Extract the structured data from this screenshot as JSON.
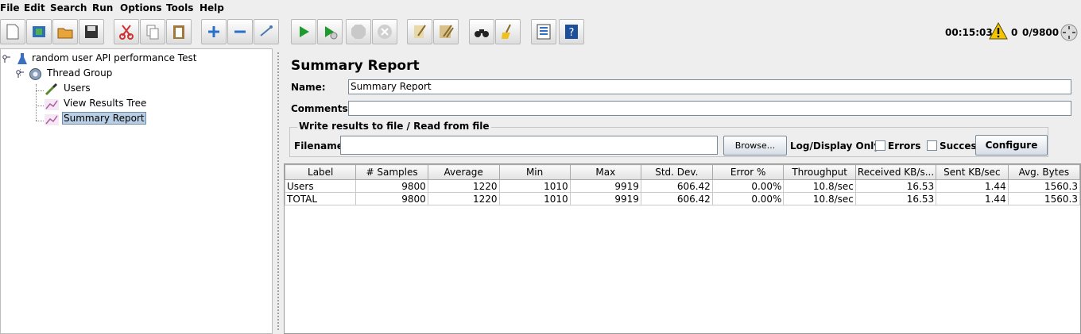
{
  "menu": {
    "file": "File",
    "edit": "Edit",
    "search": "Search",
    "run": "Run",
    "options": "Options",
    "tools": "Tools",
    "help": "Help"
  },
  "status": {
    "elapsed": "00:15:03",
    "warnings": "0",
    "threads": "0/9800"
  },
  "tree": {
    "root": "random user API performance Test",
    "thread_group": "Thread Group",
    "users": "Users",
    "view_results_tree": "View Results Tree",
    "summary_report": "Summary Report"
  },
  "panel": {
    "title": "Summary Report",
    "name_label": "Name:",
    "name_value": "Summary Report",
    "comments_label": "Comments:",
    "comments_value": "",
    "group_title": "Write results to file / Read from file",
    "filename_label": "Filename",
    "filename_value": "",
    "browse_button": "Browse...",
    "log_display_label": "Log/Display Only:",
    "errors_label": "Errors",
    "successes_label": "Successes",
    "configure_button": "Configure"
  },
  "table": {
    "columns": [
      "Label",
      "# Samples",
      "Average",
      "Min",
      "Max",
      "Std. Dev.",
      "Error %",
      "Throughput",
      "Received KB/s...",
      "Sent KB/sec",
      "Avg. Bytes"
    ],
    "rows": [
      [
        "Users",
        "9800",
        "1220",
        "1010",
        "9919",
        "606.42",
        "0.00%",
        "10.8/sec",
        "16.53",
        "1.44",
        "1560.3"
      ],
      [
        "TOTAL",
        "9800",
        "1220",
        "1010",
        "9919",
        "606.42",
        "0.00%",
        "10.8/sec",
        "16.53",
        "1.44",
        "1560.3"
      ]
    ]
  }
}
